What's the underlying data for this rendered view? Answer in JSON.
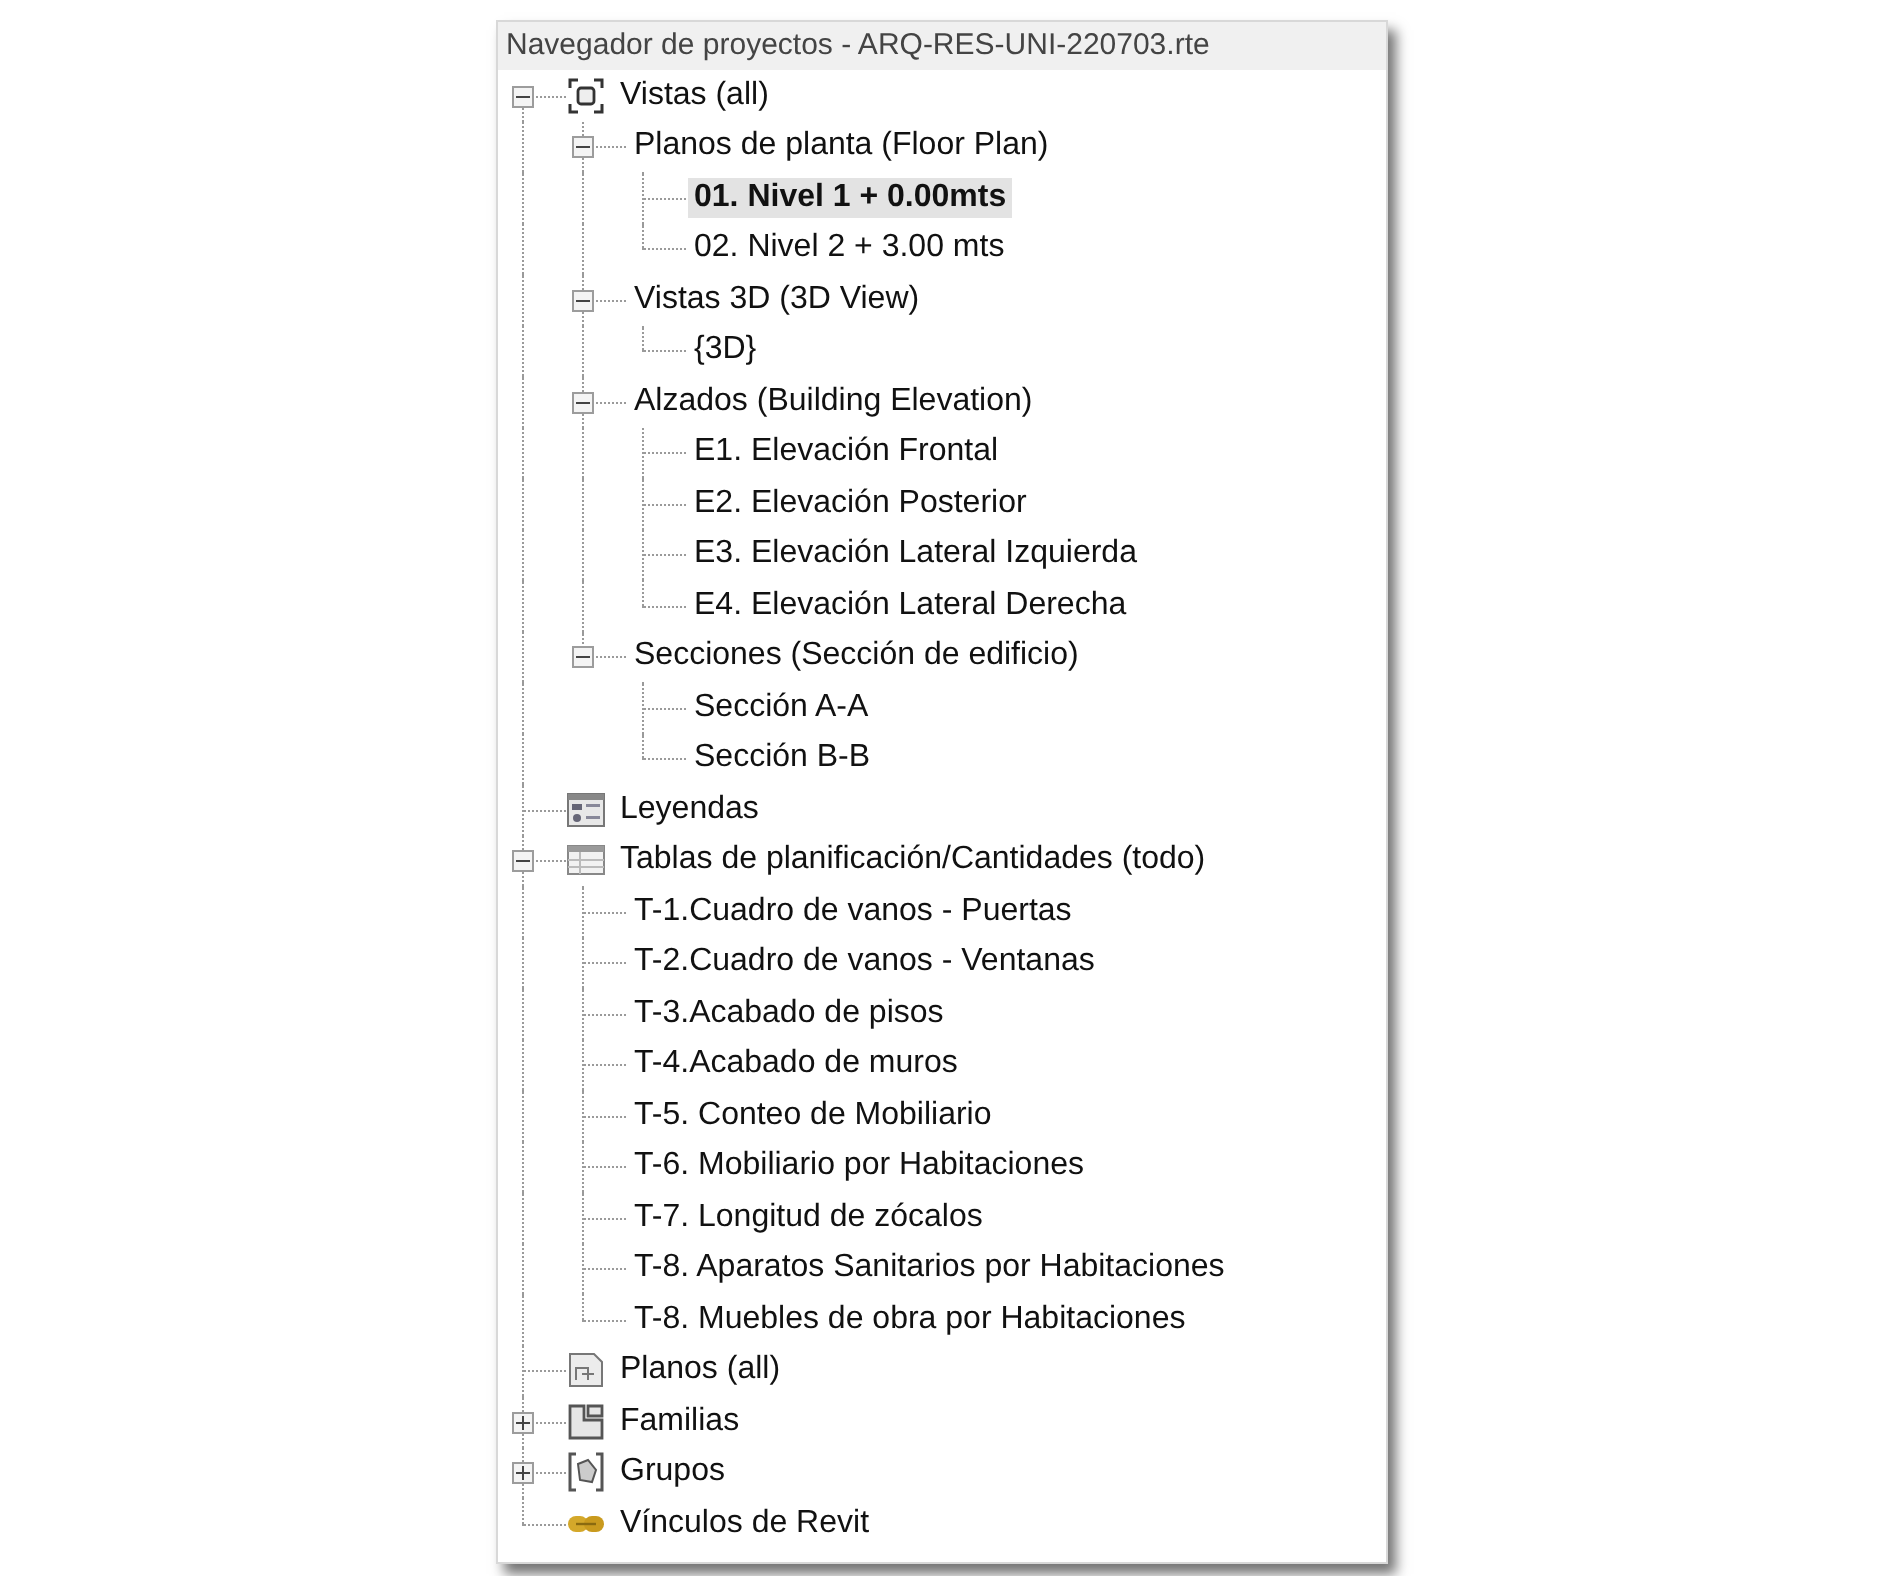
{
  "panel": {
    "title": "Navegador de proyectos - ARQ-RES-UNI-220703.rte"
  },
  "tree": [
    {
      "label": "Vistas (all)",
      "expanded": true,
      "selected": false,
      "children": [
        {
          "label": "Planos de planta (Floor Plan)",
          "expanded": true,
          "selected": false,
          "children": [
            {
              "label": "01. Nivel 1 + 0.00mts",
              "selected": true
            },
            {
              "label": "02. Nivel 2 + 3.00 mts",
              "selected": false
            }
          ]
        },
        {
          "label": "Vistas 3D (3D View)",
          "expanded": true,
          "selected": false,
          "children": [
            {
              "label": "{3D}",
              "selected": false
            }
          ]
        },
        {
          "label": "Alzados (Building Elevation)",
          "expanded": true,
          "selected": false,
          "children": [
            {
              "label": "E1. Elevación Frontal",
              "selected": false
            },
            {
              "label": "E2. Elevación Posterior",
              "selected": false
            },
            {
              "label": "E3. Elevación Lateral Izquierda",
              "selected": false
            },
            {
              "label": "E4. Elevación Lateral Derecha",
              "selected": false
            }
          ]
        },
        {
          "label": "Secciones (Sección de edificio)",
          "expanded": true,
          "selected": false,
          "children": [
            {
              "label": "Sección A-A",
              "selected": false
            },
            {
              "label": "Sección B-B",
              "selected": false
            }
          ]
        }
      ]
    },
    {
      "label": "Leyendas",
      "selected": false
    },
    {
      "label": "Tablas de planificación/Cantidades (todo)",
      "expanded": true,
      "selected": false,
      "children": [
        {
          "label": "T-1.Cuadro de vanos - Puertas",
          "selected": false
        },
        {
          "label": "T-2.Cuadro de vanos - Ventanas",
          "selected": false
        },
        {
          "label": "T-3.Acabado de pisos",
          "selected": false
        },
        {
          "label": "T-4.Acabado de muros",
          "selected": false
        },
        {
          "label": "T-5. Conteo de Mobiliario",
          "selected": false
        },
        {
          "label": "T-6. Mobiliario por Habitaciones",
          "selected": false
        },
        {
          "label": "T-7. Longitud de zócalos",
          "selected": false
        },
        {
          "label": "T-8. Aparatos Sanitarios por Habitaciones",
          "selected": false
        },
        {
          "label": "T-8. Muebles de obra por Habitaciones",
          "selected": false
        }
      ]
    },
    {
      "label": "Planos (all)",
      "selected": false
    },
    {
      "label": "Familias",
      "expanded": false,
      "selected": false
    },
    {
      "label": "Grupos",
      "expanded": false,
      "selected": false
    },
    {
      "label": "Vínculos de Revit",
      "selected": false
    }
  ]
}
